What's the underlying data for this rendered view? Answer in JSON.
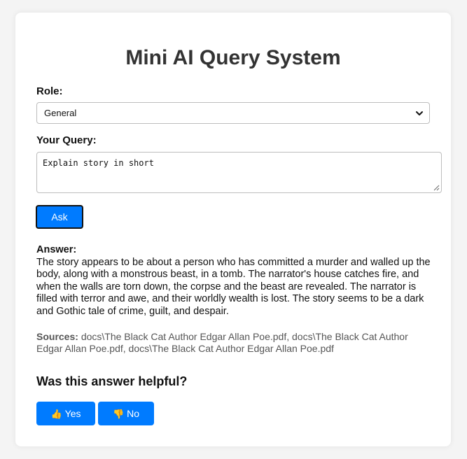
{
  "page": {
    "title": "Mini AI Query System"
  },
  "role": {
    "label": "Role:",
    "selected": "General"
  },
  "query": {
    "label": "Your Query:",
    "value": "Explain story in short"
  },
  "ask_button": {
    "label": "Ask"
  },
  "answer": {
    "label": "Answer:",
    "text": "The story appears to be about a person who has committed a murder and walled up the body, along with a monstrous beast, in a tomb. The narrator's house catches fire, and when the walls are torn down, the corpse and the beast are revealed. The narrator is filled with terror and awe, and their worldly wealth is lost. The story seems to be a dark and Gothic tale of crime, guilt, and despair."
  },
  "sources": {
    "label": "Sources:",
    "text": "docs\\The Black Cat Author Edgar Allan Poe.pdf, docs\\The Black Cat Author Edgar Allan Poe.pdf, docs\\The Black Cat Author Edgar Allan Poe.pdf"
  },
  "feedback": {
    "question": "Was this answer helpful?",
    "yes_emoji": "👍",
    "yes_label": "Yes",
    "no_emoji": "👎",
    "no_label": "No"
  },
  "colors": {
    "primary": "#007bff",
    "background": "#f4f4f4",
    "card": "#ffffff",
    "title": "#333333",
    "sources_text": "#555555"
  },
  "icons": {
    "select_arrow": "chevron-down-icon",
    "textarea_resize": "resize-grip-icon",
    "yes": "thumbs-up-icon",
    "no": "thumbs-down-icon"
  }
}
